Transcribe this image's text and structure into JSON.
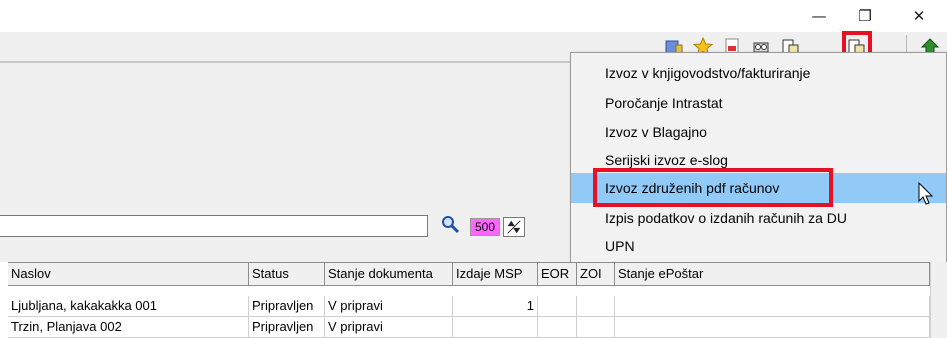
{
  "window": {
    "minimize": "—",
    "restore": "❐",
    "close": "✕"
  },
  "toolbar": {
    "icons": [
      "print-list-icon",
      "star-icon",
      "pdf-icon",
      "preview-icon",
      "export-icon",
      "export-pdf-icon",
      "exit-icon"
    ]
  },
  "filter": {
    "search_value": "",
    "limit": "500"
  },
  "menu": {
    "items": [
      "Izvoz v knjigovodstvo/fakturiranje",
      "Poročanje Intrastat",
      "Izvoz v Blagajno",
      "Serijski izvoz e-slog",
      "Izvoz združenih pdf računov",
      "Izpis podatkov o izdanih računih za DU",
      "UPN"
    ],
    "highlighted_index": 4
  },
  "table": {
    "columns": [
      "Naslov",
      "Status",
      "Stanje dokumenta",
      "Izdaje MSP",
      "EOR",
      "ZOI",
      "Stanje ePoštar"
    ],
    "rows": [
      [
        "Ljubljana, kakakakka 001",
        "Pripravljen",
        "V pripravi",
        "1",
        "",
        "",
        ""
      ],
      [
        "Trzin, Planjava 002",
        "Pripravljen",
        "V pripravi",
        "",
        "",
        "",
        ""
      ]
    ]
  }
}
